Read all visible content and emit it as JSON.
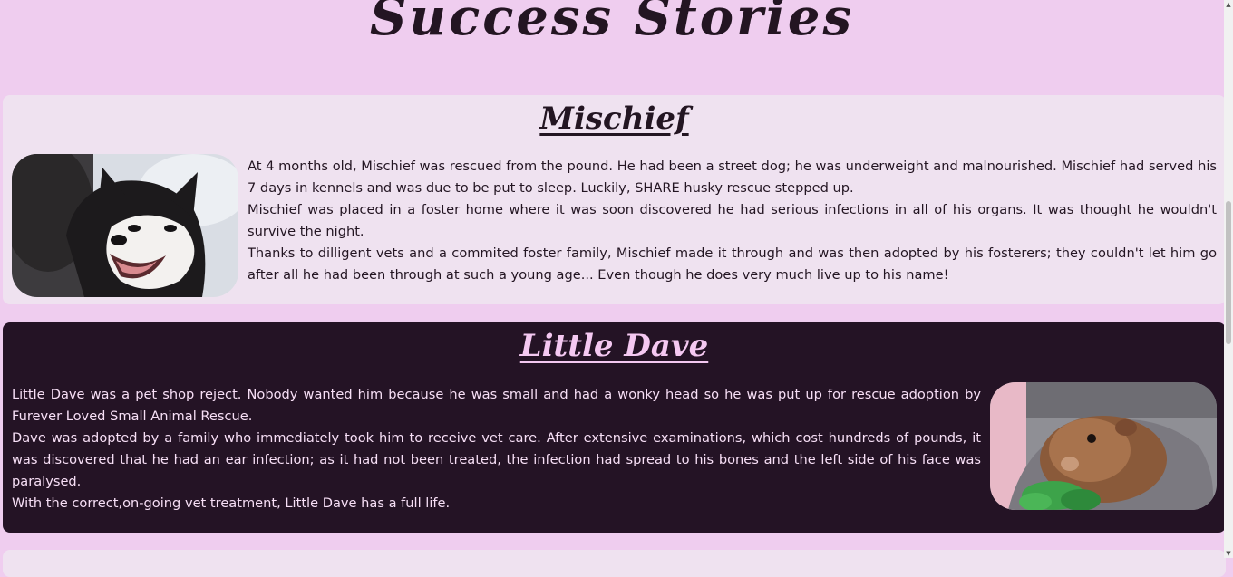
{
  "page": {
    "title": "Success Stories"
  },
  "stories": [
    {
      "name": "Mischief",
      "image_alt": "husky-dog-photo",
      "paragraphs": [
        "At 4 months old, Mischief was rescued from the pound. He had been a street dog; he was underweight and malnourished. Mischief had served his 7 days in kennels and was due to be put to sleep. Luckily, SHARE husky rescue stepped up.",
        "Mischief was placed in a foster home where it was soon discovered he had serious infections in all of his organs. It was thought he wouldn't survive the night.",
        "Thanks to dilligent vets and a commited foster family, Mischief made it through and was then adopted by his fosterers; they couldn't let him go after all he had been through at such a young age... Even though he does very much live up to his name!"
      ]
    },
    {
      "name": "Little Dave",
      "image_alt": "guinea-pig-photo",
      "paragraphs": [
        "Little Dave was a pet shop reject. Nobody wanted him because he was small and had a wonky head so he was put up for rescue adoption by Furever Loved Small Animal Rescue.",
        "Dave was adopted by a family who immediately took him to receive vet care. After extensive examinations, which cost hundreds of pounds, it was discovered that he had an ear infection; as it had not been treated, the infection had spread to his bones and the left side of his face was paralysed.",
        "With the correct,on-going vet treatment, Little Dave has a full life."
      ]
    }
  ],
  "colors": {
    "page_bg": "#efcdef",
    "card_light": "#efe2f0",
    "card_dark": "#241325",
    "text_dark": "#231522",
    "heading_pink": "#f4c8f1"
  },
  "scrollbar": {
    "up_icon": "scroll-up-arrow-icon",
    "down_icon": "scroll-down-arrow-icon"
  }
}
